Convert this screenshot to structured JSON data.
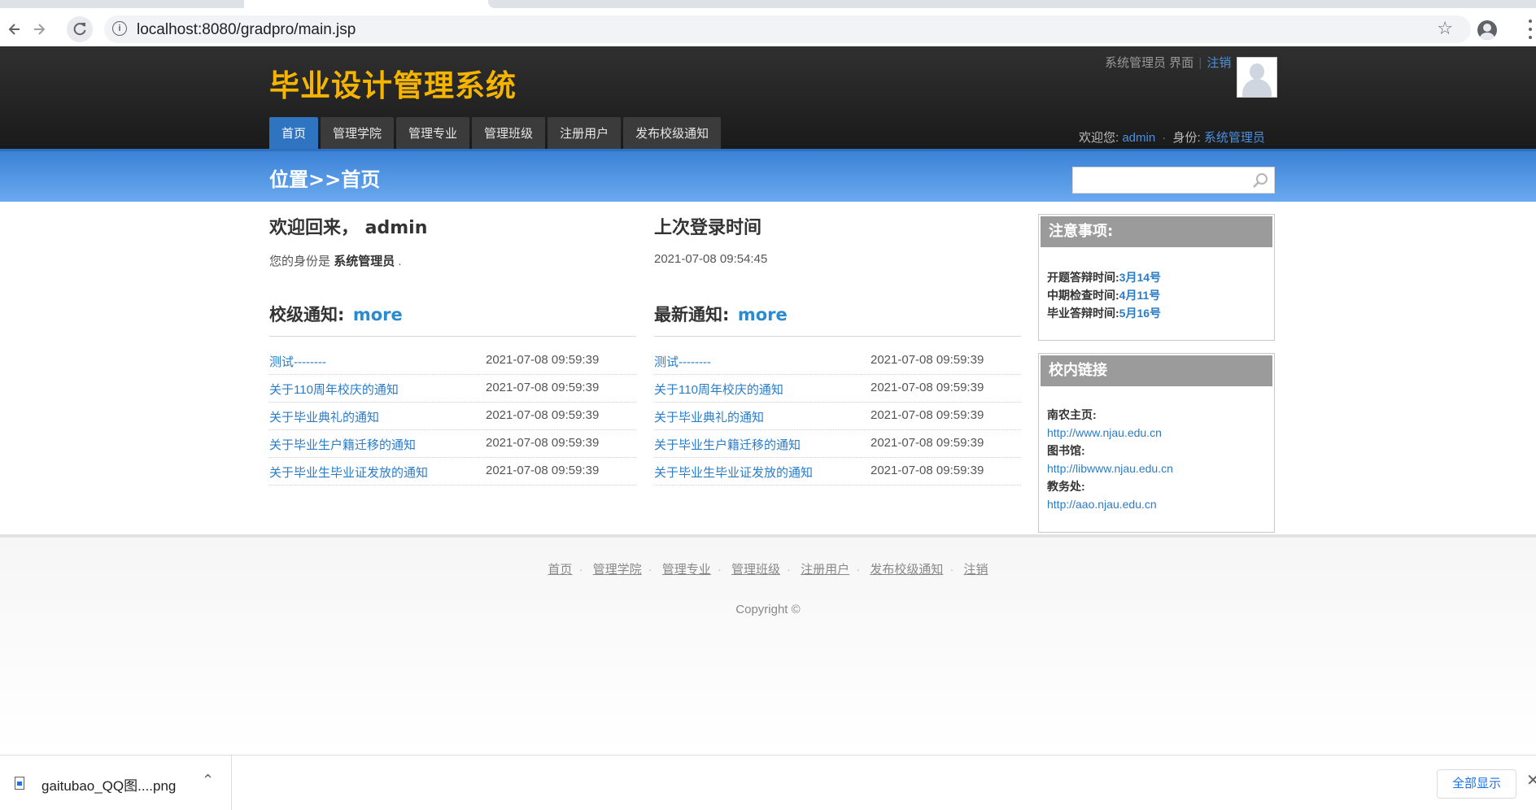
{
  "browser": {
    "url": "localhost:8080/gradpro/main.jsp",
    "icons": [
      "back-icon",
      "forward-icon",
      "reload-icon",
      "info-icon",
      "star-icon",
      "profile-icon",
      "menu-icon"
    ]
  },
  "header": {
    "logo": "毕业设计管理系统",
    "role_label": "系统管理员 界面",
    "sep": "|",
    "logout": "注销",
    "nav": [
      "首页",
      "管理学院",
      "管理专业",
      "管理班级",
      "注册用户",
      "发布校级通知"
    ],
    "welcome_prefix": "欢迎您:",
    "username": "admin",
    "dot": "·",
    "identity_prefix": "身份:",
    "identity": "系统管理员"
  },
  "breadcrumb": {
    "text": "位置>>首页",
    "search_placeholder": ""
  },
  "welcome": {
    "title": "欢迎回来，  admin",
    "identity_prefix": "您的身份是",
    "identity": "系统管理员",
    "identity_suffix": "."
  },
  "last_login": {
    "title": "上次登录时间",
    "time": "2021-07-08 09:54:45"
  },
  "school_notices": {
    "title": "校级通知:",
    "more": "more",
    "items": [
      {
        "title": "测试--------",
        "time": "2021-07-08 09:59:39"
      },
      {
        "title": "关于110周年校庆的通知",
        "time": "2021-07-08 09:59:39"
      },
      {
        "title": "关于毕业典礼的通知",
        "time": "2021-07-08 09:59:39"
      },
      {
        "title": "关于毕业生户籍迁移的通知",
        "time": "2021-07-08 09:59:39"
      },
      {
        "title": "关于毕业生毕业证发放的通知",
        "time": "2021-07-08 09:59:39"
      }
    ]
  },
  "latest_notices": {
    "title": "最新通知:",
    "more": "more",
    "items": [
      {
        "title": "测试--------",
        "time": "2021-07-08 09:59:39"
      },
      {
        "title": "关于110周年校庆的通知",
        "time": "2021-07-08 09:59:39"
      },
      {
        "title": "关于毕业典礼的通知",
        "time": "2021-07-08 09:59:39"
      },
      {
        "title": "关于毕业生户籍迁移的通知",
        "time": "2021-07-08 09:59:39"
      },
      {
        "title": "关于毕业生毕业证发放的通知",
        "time": "2021-07-08 09:59:39"
      }
    ]
  },
  "notes": {
    "title": "注意事项:",
    "items": [
      {
        "label": "开题答辩时间:",
        "value": "3月14号"
      },
      {
        "label": "中期检查时间:",
        "value": "4月11号"
      },
      {
        "label": "毕业答辩时间:",
        "value": "5月16号"
      }
    ]
  },
  "campus_links": {
    "title": "校内链接",
    "items": [
      {
        "label": "南农主页:",
        "url": "http://www.njau.edu.cn"
      },
      {
        "label": "图书馆:",
        "url": "http://libwww.njau.edu.cn"
      },
      {
        "label": "教务处:",
        "url": "http://aao.njau.edu.cn"
      }
    ]
  },
  "footer": {
    "links": [
      "首页",
      "管理学院",
      "管理专业",
      "管理班级",
      "注册用户",
      "发布校级通知",
      "注销"
    ],
    "sep": "·",
    "copyright": "Copyright ©"
  },
  "downloads": {
    "filename": "gaitubao_QQ图....png",
    "show_all": "全部显示"
  },
  "colors": {
    "logo": "#f5b400",
    "nav_active": "#2f74c0",
    "link": "#2a7cc7",
    "header_bg": "#1f1f1f",
    "crumb_bar": "#4a90e2"
  }
}
